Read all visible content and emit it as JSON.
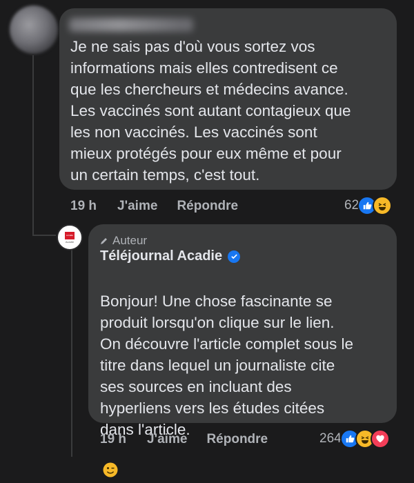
{
  "comment": {
    "text": "Je ne sais pas d'où vous sortez vos\ninformations mais elles contredisent ce\nque les chercheurs et médecins avance.\nLes vaccinés sont autant contagieux que\nles non vaccinés. Les vaccinés sont\nmieux protégés pour eux même et pour\nun certain temps, c'est tout.",
    "time": "19 h",
    "like_label": "J'aime",
    "reply_label": "Répondre",
    "reaction_count": "62",
    "reactions": [
      "like",
      "haha"
    ]
  },
  "reply": {
    "badge_icon": "pencil-icon",
    "badge": "Auteur",
    "author": "Téléjournal Acadie",
    "verified": true,
    "text": "Bonjour! Une chose fascinante se\nproduit lorsqu'on clique sur le lien.\nOn découvre l'article complet sous le\ntitre dans lequel un journaliste cite\nses sources en incluant des\nhyperliens vers les études citées\ndans l'article.",
    "emoji_icon": "wink-emoji-icon",
    "time": "19 h",
    "like_label": "J'aime",
    "reply_label": "Répondre",
    "reaction_count": "264",
    "reactions": [
      "like",
      "haha",
      "love"
    ],
    "logo_line1": "ici télé",
    "logo_line2": "Acadie"
  },
  "colors": {
    "background": "#1b1b1c",
    "bubble": "#3a3b3c",
    "text": "#e4e6eb",
    "secondary": "#b0b3b8",
    "like_blue": "#1877f2",
    "haha_yellow": "#f7b928",
    "love_red": "#f33e58",
    "brand_red": "#d61b2a"
  }
}
